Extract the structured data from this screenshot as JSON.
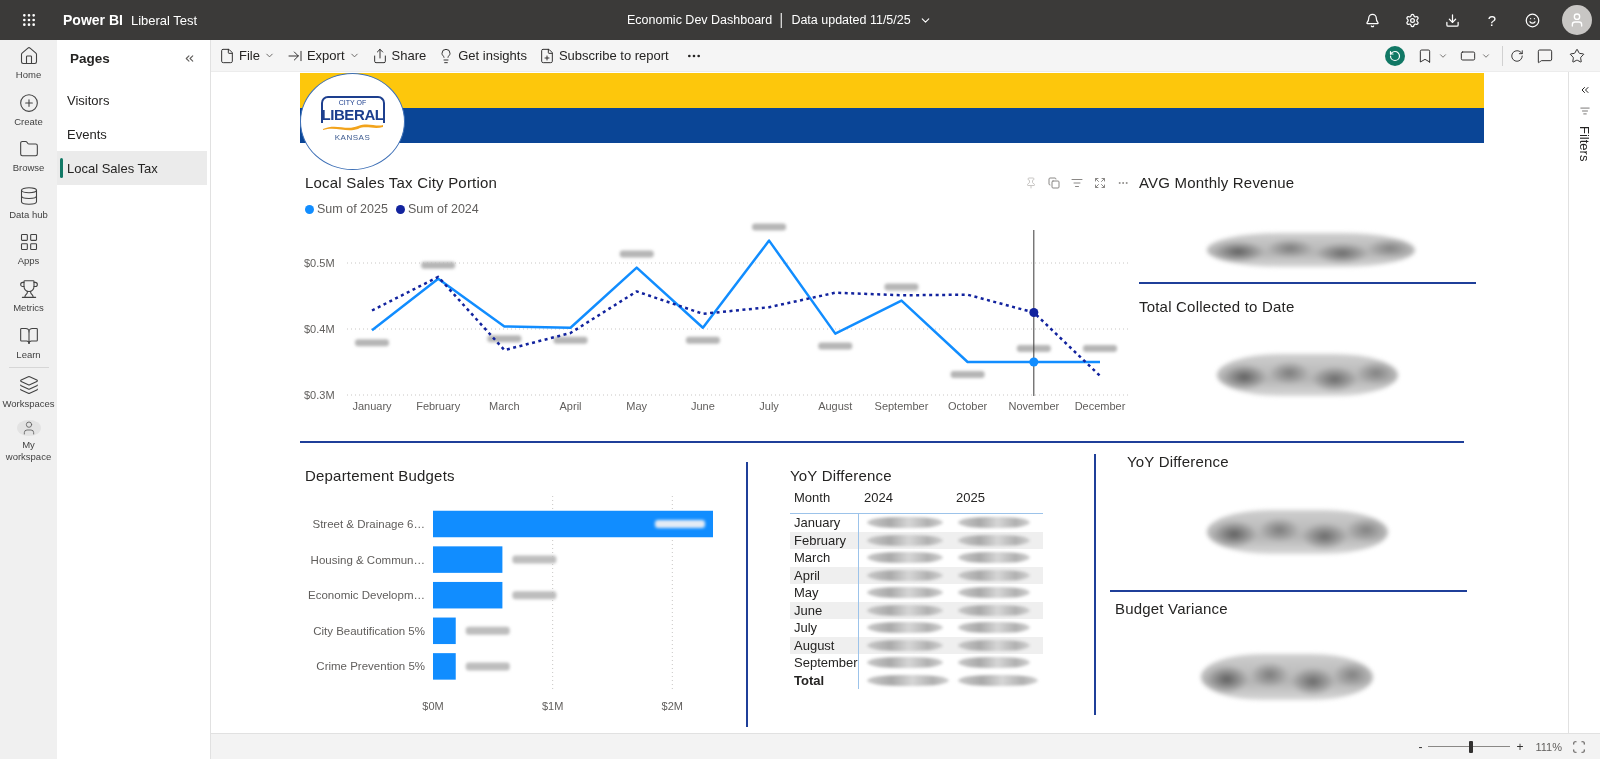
{
  "top_bar": {
    "app_name": "Power BI",
    "workspace_name": "Liberal Test",
    "report_title": "Economic Dev Dashboard",
    "separator": "|",
    "data_updated": "Data updated 11/5/25",
    "help_button": "?"
  },
  "nav_rail": {
    "main_items": [
      {
        "label": "Home",
        "selected": false
      },
      {
        "label": "Create",
        "selected": false
      },
      {
        "label": "Browse",
        "selected": false
      },
      {
        "label": "Data hub",
        "selected": false
      },
      {
        "label": "Apps",
        "selected": false
      },
      {
        "label": "Metrics",
        "selected": false
      },
      {
        "label": "Learn",
        "selected": false
      }
    ],
    "workspace_items": [
      {
        "label": "Workspaces",
        "selected": false
      },
      {
        "label": "My workspace",
        "selected": false
      }
    ]
  },
  "pages_pane": {
    "title": "Pages",
    "pages": [
      {
        "label": "Visitors",
        "selected": false
      },
      {
        "label": "Events",
        "selected": false
      },
      {
        "label": "Local Sales Tax",
        "selected": true
      }
    ]
  },
  "toolbar": {
    "actions": [
      {
        "label": "File",
        "has_menu": true
      },
      {
        "label": "Export",
        "has_menu": true
      },
      {
        "label": "Share",
        "has_menu": false
      },
      {
        "label": "Get insights",
        "has_menu": false
      },
      {
        "label": "Subscribe to report",
        "has_menu": false
      }
    ]
  },
  "report": {
    "logo": {
      "top_text": "CITY OF",
      "name": "LIBERAL",
      "bottom_text": "KANSAS"
    },
    "line_visual": {
      "title": "Local Sales Tax City Portion",
      "chart_data": {
        "type": "line",
        "categories": [
          "January",
          "February",
          "March",
          "April",
          "May",
          "June",
          "July",
          "August",
          "September",
          "October",
          "November",
          "December"
        ],
        "series": [
          {
            "name": "Sum of 2025",
            "color": "#118dff",
            "line_style": "solid",
            "values": [
              0.398,
              0.476,
              0.404,
              0.402,
              0.493,
              0.402,
              0.534,
              0.393,
              0.443,
              0.35,
              0.35,
              0.35
            ]
          },
          {
            "name": "Sum of 2024",
            "color": "#12239e",
            "line_style": "dashed",
            "values": [
              0.428,
              0.479,
              0.368,
              0.394,
              0.457,
              0.423,
              0.433,
              0.455,
              0.451,
              0.452,
              0.425,
              0.329
            ]
          }
        ],
        "ylim": [
          0.3,
          0.55
        ],
        "yticks": [
          {
            "value": 0.3,
            "label": "$0.3M"
          },
          {
            "value": 0.4,
            "label": "$0.4M"
          },
          {
            "value": 0.5,
            "label": "$0.5M"
          }
        ],
        "ref_lines": [
          {
            "axis": "x",
            "value": "November"
          }
        ]
      }
    },
    "top_cards": [
      {
        "title": "AVG Monthly Revenue"
      },
      {
        "title": "Total Collected to Date"
      }
    ],
    "bar_visual": {
      "title": "Departement Budgets",
      "chart_data": {
        "type": "bar",
        "orientation": "horizontal",
        "categories": [
          "Street & Drainage 6…",
          "Housing & Commun…",
          "Economic Developm…",
          "City Beautification 5%",
          "Crime Prevention 5%"
        ],
        "values": [
          2.34,
          0.58,
          0.58,
          0.19,
          0.19
        ],
        "xlim": [
          0,
          2.34
        ],
        "xticks": [
          {
            "value": 0,
            "label": "$0M"
          },
          {
            "value": 1,
            "label": "$1M"
          },
          {
            "value": 2,
            "label": "$2M"
          }
        ]
      }
    },
    "table_visual": {
      "title": "YoY Difference",
      "columns": [
        "Month",
        "2024",
        "2025"
      ],
      "rows": [
        {
          "month": "January",
          "kind": "data"
        },
        {
          "month": "February",
          "kind": "data"
        },
        {
          "month": "March",
          "kind": "data"
        },
        {
          "month": "April",
          "kind": "data"
        },
        {
          "month": "May",
          "kind": "data"
        },
        {
          "month": "June",
          "kind": "data"
        },
        {
          "month": "July",
          "kind": "data"
        },
        {
          "month": "August",
          "kind": "data"
        },
        {
          "month": "September",
          "kind": "data"
        },
        {
          "month": "Total",
          "kind": "total"
        }
      ]
    },
    "bottom_cards": [
      {
        "title": "YoY Difference"
      },
      {
        "title": "Budget Variance"
      }
    ]
  },
  "filters_pane": {
    "label": "Filters"
  },
  "status_bar": {
    "zoom_out": "-",
    "zoom_slider": {
      "level": 0.52
    },
    "zoom_in": "+",
    "zoom_reading": "111%"
  }
}
